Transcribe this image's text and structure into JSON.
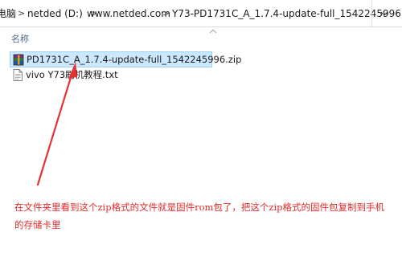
{
  "address_bar": {
    "crumbs": [
      {
        "label": "电脑"
      },
      {
        "label": "netded (D:)"
      },
      {
        "label": "www.netded.com"
      },
      {
        "label": "Y73-PD1731C_A_1.7.4-update-full_1542245996"
      }
    ],
    "separator": ">"
  },
  "list": {
    "column_name": "名称"
  },
  "files": [
    {
      "name": "PD1731C_A_1.7.4-update-full_1542245996.zip",
      "icon": "winrar-archive-icon",
      "selected": true
    },
    {
      "name": "vivo Y73刷机教程.txt",
      "icon": "text-file-icon",
      "selected": false
    }
  ],
  "annotation": {
    "text": "在文件夹里看到这个zip格式的文件就是固件rom包了，把这个zip格式的固件包复制到手机的存储卡里",
    "color": "#e52a2a"
  }
}
